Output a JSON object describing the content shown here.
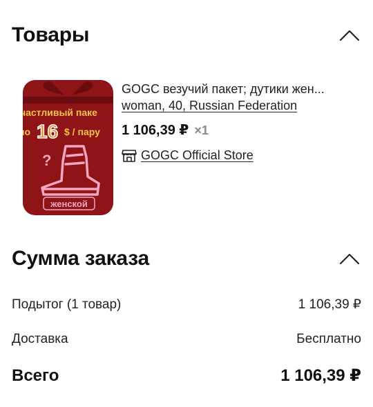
{
  "products_section": {
    "title": "Товары",
    "items": [
      {
        "title": "GOGC везучий пакет; дутики жен...",
        "variant": "woman, 40, Russian Federation",
        "price": "1 106,39 ₽",
        "quantity": "×1",
        "store": "GOGC Official Store",
        "image": {
          "line1": "частливый паке",
          "prefix": "по",
          "number": "16",
          "suffix": "$ / пару",
          "question": "?",
          "badge": "женской",
          "colors": {
            "background": "#8e1418",
            "banner": "#f4c542",
            "number": "#f08a24",
            "boot": "#f5a6c1"
          }
        }
      }
    ]
  },
  "summary_section": {
    "title": "Сумма заказа",
    "subtotal_label": "Подытог (1 товар)",
    "subtotal_value": "1 106,39 ₽",
    "delivery_label": "Доставка",
    "delivery_value": "Бесплатно",
    "total_label": "Всего",
    "total_value": "1 106,39 ₽"
  },
  "icons": {
    "collapse": "chevron-up-icon",
    "store": "store-icon"
  }
}
